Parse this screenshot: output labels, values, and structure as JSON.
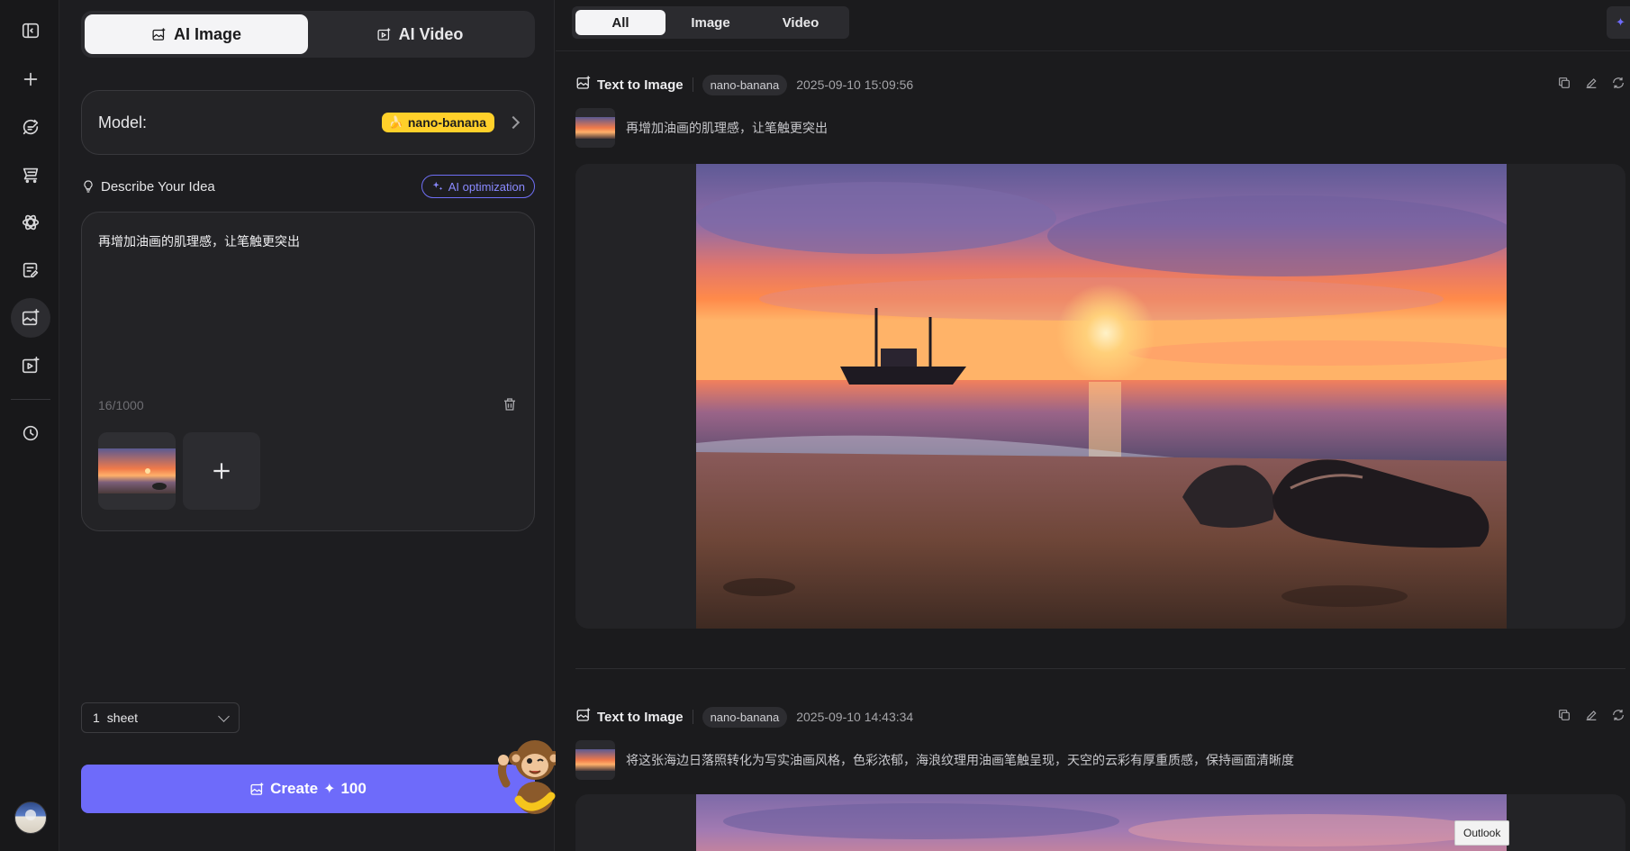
{
  "rail": {
    "items": [
      {
        "name": "sidebar-toggle-icon"
      },
      {
        "name": "new-icon"
      },
      {
        "name": "chat-edit-icon"
      },
      {
        "name": "cart-icon"
      },
      {
        "name": "atom-icon"
      },
      {
        "name": "edit-note-icon"
      },
      {
        "name": "image-gen-icon"
      },
      {
        "name": "video-gen-icon"
      },
      {
        "name": "history-icon"
      }
    ]
  },
  "panel": {
    "tabs": [
      {
        "label": "AI Image",
        "icon": "image-icon",
        "active": true
      },
      {
        "label": "AI Video",
        "icon": "video-icon",
        "active": false
      }
    ],
    "model": {
      "label": "Model:",
      "value": "nano-banana",
      "chip_color": "#ffd02a"
    },
    "idea": {
      "label": "Describe Your Idea",
      "ai_optimization": "AI optimization"
    },
    "prompt": {
      "text": "再增加油画的肌理感，让笔触更突出",
      "char_count": "16/1000"
    },
    "sheet": {
      "count": "1",
      "unit": "sheet"
    },
    "create": {
      "label": "Create",
      "cost": "100",
      "color": "#6e6bfa"
    }
  },
  "main": {
    "filters": [
      {
        "label": "All",
        "active": true
      },
      {
        "label": "Image",
        "active": false
      },
      {
        "label": "Video",
        "active": false
      }
    ],
    "generations": [
      {
        "type": "Text to Image",
        "model": "nano-banana",
        "time": "2025-09-10 15:09:56",
        "prompt": "再增加油画的肌理感，让笔触更突出"
      },
      {
        "type": "Text to Image",
        "model": "nano-banana",
        "time": "2025-09-10 14:43:34",
        "prompt": "将这张海边日落照转化为写实油画风格，色彩浓郁，海浪纹理用油画笔触呈现，天空的云彩有厚重质感，保持画面清晰度"
      }
    ]
  },
  "tooltip": "Outlook"
}
